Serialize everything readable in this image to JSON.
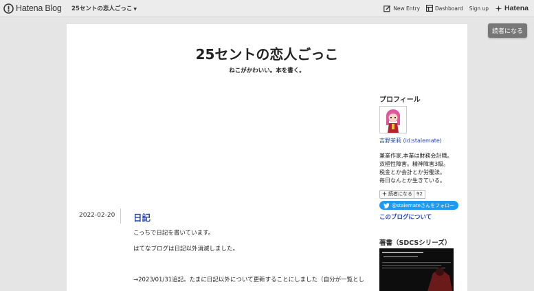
{
  "header": {
    "logo_text": "Hatena Blog",
    "blog_switcher": "25セントの恋人ごっこ",
    "new_entry": "New Entry",
    "dashboard": "Dashboard",
    "signup": "Sign up",
    "hatena": "Hatena"
  },
  "subscribe_float": "読者になる",
  "blog": {
    "title": "25セントの恋人ごっこ",
    "description": "ねこがかわいい。本を書く。"
  },
  "entry": {
    "date": "2022-02-20",
    "title": "日記",
    "paragraphs": [
      "こっちで日記を書いています。",
      "はてなブログは日記以外消滅しました。",
      "→2023/01/31追記。たまに日記以外について更新することにしました（自分が一覧とし"
    ]
  },
  "sidebar": {
    "profile_heading": "プロフィール",
    "profile_name": "吉野茉莉 (id:stalemate)",
    "profile_desc": [
      "兼業作家,本業は財務会計職。",
      "双極性障害。精神障害3級。",
      "税金とか会計とか労働法。",
      "毎日なんとか生きている。"
    ],
    "subscribe_label": "読者になる",
    "subscriber_count": "92",
    "follow_label": "@stalemateさんをフォロー",
    "about_link": "このブログについて",
    "books_heading": "著書（SDCSシリーズ）"
  },
  "colors": {
    "accent_link": "#2244aa",
    "twitter": "#1d9bf0"
  }
}
